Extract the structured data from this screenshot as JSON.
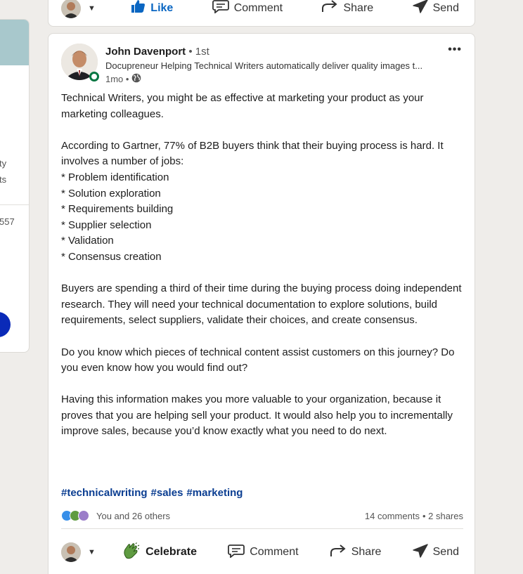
{
  "sidebar_fragments": [
    "ty",
    "ts",
    "557"
  ],
  "previous_post": {
    "actions": {
      "like": "Like",
      "comment": "Comment",
      "share": "Share",
      "send": "Send"
    }
  },
  "post": {
    "author": {
      "name": "John Davenport",
      "degree": "• 1st",
      "headline": "Docupreneur Helping Technical Writers automatically deliver quality images t...",
      "time": "1mo •",
      "visibility_icon": "globe-icon"
    },
    "body": [
      "Technical Writers, you might be as effective at marketing your product as your marketing colleagues.",
      "",
      "According to Gartner, 77% of B2B buyers think that their buying process is hard. It involves a number of jobs:",
      "* Problem identification",
      "* Solution exploration",
      "* Requirements building",
      "* Supplier selection",
      "* Validation",
      "* Consensus creation",
      "",
      "Buyers are spending a third of their time during the buying process doing independent research. They will need your technical documentation to explore solutions, build requirements, select suppliers, validate their choices, and create consensus.",
      "",
      "Do you know which pieces of technical content assist customers on this journey? Do you even know how you would find out?",
      "",
      "Having this information makes you more valuable to your organization, because it proves that you are helping sell your product. It would also help you to incrementally improve sales, because you’d know exactly what you need to do next."
    ],
    "hashtags": [
      "#technicalwriting",
      "#sales",
      "#marketing"
    ],
    "reactions_text": "You and 26 others",
    "comments_text": "14 comments",
    "shares_text": "• 2 shares",
    "actions": {
      "celebrate": "Celebrate",
      "comment": "Comment",
      "share": "Share",
      "send": "Send"
    }
  },
  "colors": {
    "link_blue": "#0a3d91",
    "like_blue": "#0a66c2",
    "online_green": "#057642",
    "sidebar_banner": "#a8c8cc",
    "sidebar_button": "#0a2ab8"
  }
}
